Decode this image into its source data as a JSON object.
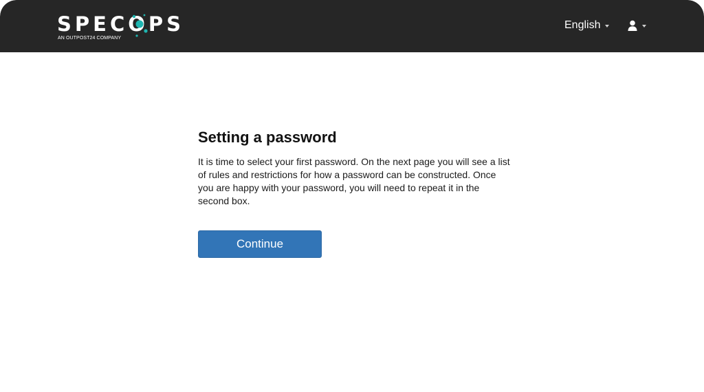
{
  "header": {
    "logo_text": "SPECOPS",
    "logo_tagline": "AN OUTPOST24 COMPANY",
    "language": {
      "selected": "English",
      "icon": "chevron-down-icon"
    },
    "user_menu": {
      "icon": "user-icon",
      "dropdown_icon": "chevron-down-icon"
    }
  },
  "main": {
    "title": "Setting a password",
    "description": "It is time to select your first password. On the next page you will see a list of rules and restrictions for how a password can be constructed. Once you are happy with your password, you will need to repeat it in the second box.",
    "continue_label": "Continue"
  },
  "colors": {
    "header_bg": "#262626",
    "primary_button": "#3275b7",
    "logo_accent": "#1fb5b0"
  }
}
